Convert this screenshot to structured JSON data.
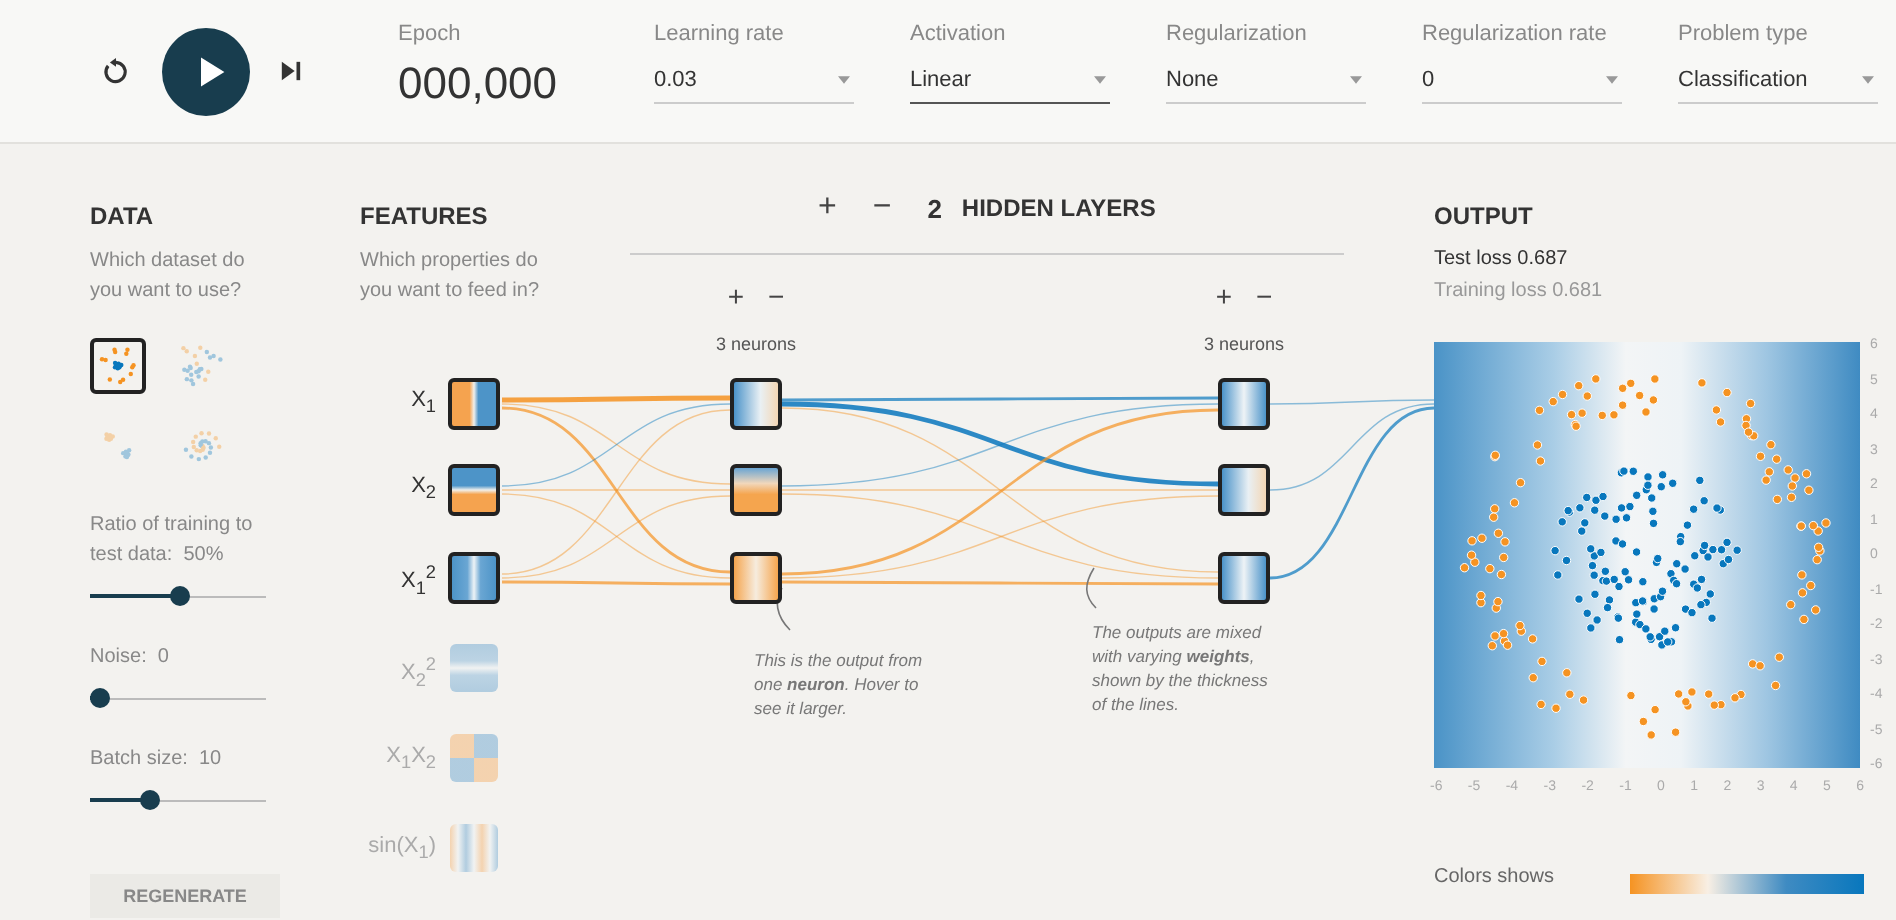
{
  "toolbar": {
    "epoch_label": "Epoch",
    "epoch": "000,000",
    "dropdowns": [
      {
        "label": "Learning rate",
        "value": "0.03",
        "focused": false
      },
      {
        "label": "Activation",
        "value": "Linear",
        "focused": true
      },
      {
        "label": "Regularization",
        "value": "None",
        "focused": false
      },
      {
        "label": "Regularization rate",
        "value": "0",
        "focused": false
      },
      {
        "label": "Problem type",
        "value": "Classification",
        "focused": false
      }
    ]
  },
  "data": {
    "title": "DATA",
    "description": "Which dataset do you want to use?",
    "datasets": [
      {
        "kind": "circle",
        "selected": true
      },
      {
        "kind": "xor",
        "selected": false
      },
      {
        "kind": "gauss",
        "selected": false
      },
      {
        "kind": "spiral",
        "selected": false
      }
    ],
    "sliders": [
      {
        "label": "Ratio of training to test data:",
        "reading": "50%",
        "level": 0.51
      },
      {
        "label": "Noise:",
        "reading": "0",
        "level": 0
      },
      {
        "label": "Batch size:",
        "reading": "10",
        "level": 0.32
      }
    ],
    "button": "REGENERATE"
  },
  "features": {
    "title": "FEATURES",
    "description": "Which properties do you want to feed in?",
    "items": [
      {
        "label": "X$_{1}$",
        "selected": true,
        "kind": "split-vertical"
      },
      {
        "label": "X$_{2}$",
        "selected": true,
        "kind": "split-horizontal"
      },
      {
        "label": "X$_{1}$$^{2}$",
        "selected": true,
        "kind": "stripe-vertical"
      },
      {
        "label": "X$_{2}$$^{2}$",
        "selected": false,
        "kind": "stripe-horizontal"
      },
      {
        "label": "X$_{1}$X$_{2}$",
        "selected": false,
        "kind": "checker"
      },
      {
        "label": "sin(X$_{1}$)",
        "selected": false,
        "kind": "waves"
      }
    ]
  },
  "network": {
    "add": "+",
    "remove": "−",
    "count": "2",
    "title": "HIDDEN LAYERS",
    "layers": [
      {
        "add": "+",
        "remove": "−",
        "caption": "3 neurons",
        "neurons": [
          {
            "kind": "blue-left"
          },
          {
            "kind": "orange-bottom"
          },
          {
            "kind": "orange-stripe"
          }
        ]
      },
      {
        "add": "+",
        "remove": "−",
        "caption": "3 neurons",
        "neurons": [
          {
            "kind": "blue-stripe"
          },
          {
            "kind": "blue-left"
          },
          {
            "kind": "blue-stripe"
          }
        ]
      }
    ],
    "notes": [
      "This is the output from one **neuron**. Hover to see it larger.",
      "The outputs are mixed with varying **weights**, shown by the thickness of the lines."
    ]
  },
  "output": {
    "title": "OUTPUT",
    "test_loss": "Test loss 0.687",
    "training_loss": "Training loss 0.681",
    "y_ticks": [
      "6",
      "5",
      "4",
      "3",
      "2",
      "1",
      "0",
      "-1",
      "-2",
      "-3",
      "-4",
      "-5",
      "-6"
    ],
    "x_ticks": [
      "-6",
      "-5",
      "-4",
      "-3",
      "-2",
      "-1",
      "0",
      "1",
      "2",
      "3",
      "4",
      "5",
      "6"
    ],
    "legend": "Colors shows"
  }
}
